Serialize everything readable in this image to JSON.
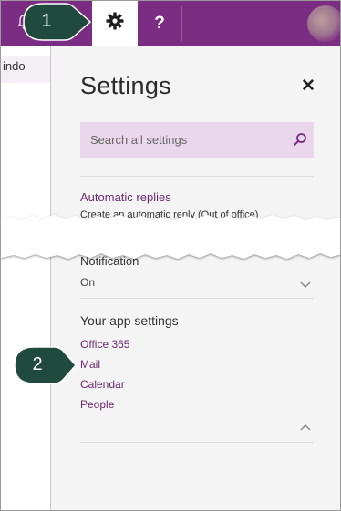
{
  "topbar": {
    "help_label": "?"
  },
  "left_pane": {
    "folder_label": "indo"
  },
  "settings": {
    "title": "Settings",
    "close_label": "✕",
    "search": {
      "placeholder": "Search all settings"
    },
    "automatic_replies": {
      "label": "Automatic replies",
      "description": "Create an automatic reply (Out of office)"
    },
    "notifications": {
      "label": "Notification",
      "value": "On"
    },
    "app_settings": {
      "heading": "Your app settings",
      "items": [
        "Office 365",
        "Mail",
        "Calendar",
        "People"
      ]
    }
  },
  "callouts": [
    "1",
    "2"
  ],
  "colors": {
    "brand": "#7b2d83",
    "search_bg": "#ead7ec",
    "callout": "#1f4a3d"
  }
}
